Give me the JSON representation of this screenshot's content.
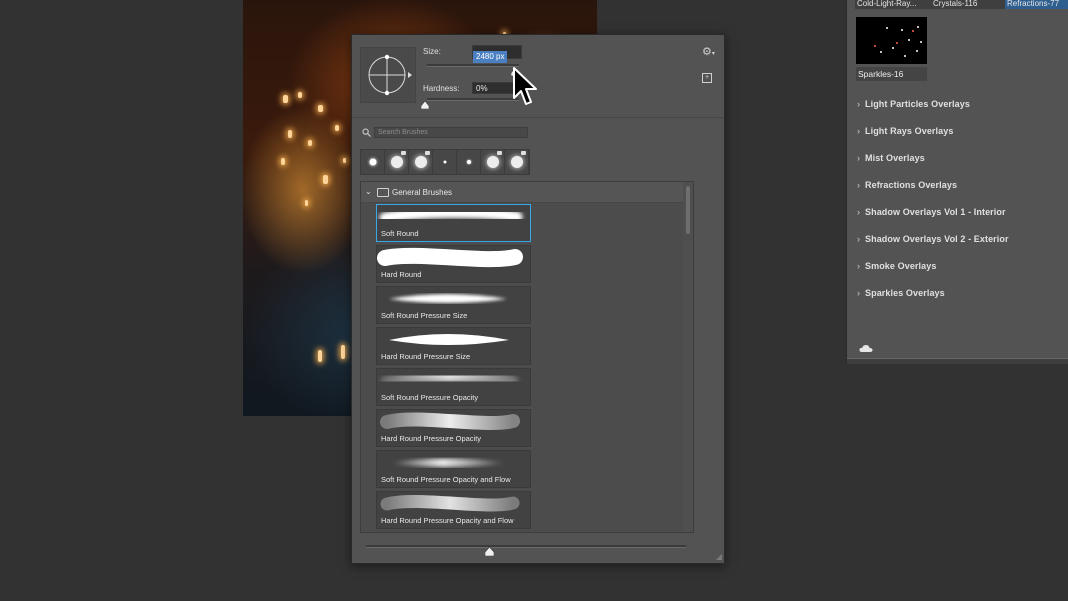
{
  "brush_panel": {
    "size_label": "Size:",
    "size_value": "2480 px",
    "hardness_label": "Hardness:",
    "hardness_value": "0%",
    "search_placeholder": "Search Brushes",
    "group_name": "General Brushes",
    "brushes": [
      {
        "name": "Soft Round"
      },
      {
        "name": "Hard Round"
      },
      {
        "name": "Soft Round Pressure Size"
      },
      {
        "name": "Hard Round Pressure Size"
      },
      {
        "name": "Soft Round Pressure Opacity"
      },
      {
        "name": "Hard Round Pressure Opacity"
      },
      {
        "name": "Soft Round Pressure Opacity and Flow"
      },
      {
        "name": "Hard Round Pressure Opacity and Flow"
      }
    ]
  },
  "overlays_panel": {
    "top_tabs": [
      "Cold-Light-Ray...",
      "Crystals-116",
      "Refractions-77"
    ],
    "selected_thumbnail": "Sparkles-16",
    "folders": [
      "Light Particles Overlays",
      "Light Rays Overlays",
      "Mist Overlays",
      "Refractions Overlays",
      "Shadow Overlays Vol 1 - Interior",
      "Shadow Overlays Vol 2 - Exterior",
      "Smoke Overlays",
      "Sparkles Overlays"
    ]
  }
}
